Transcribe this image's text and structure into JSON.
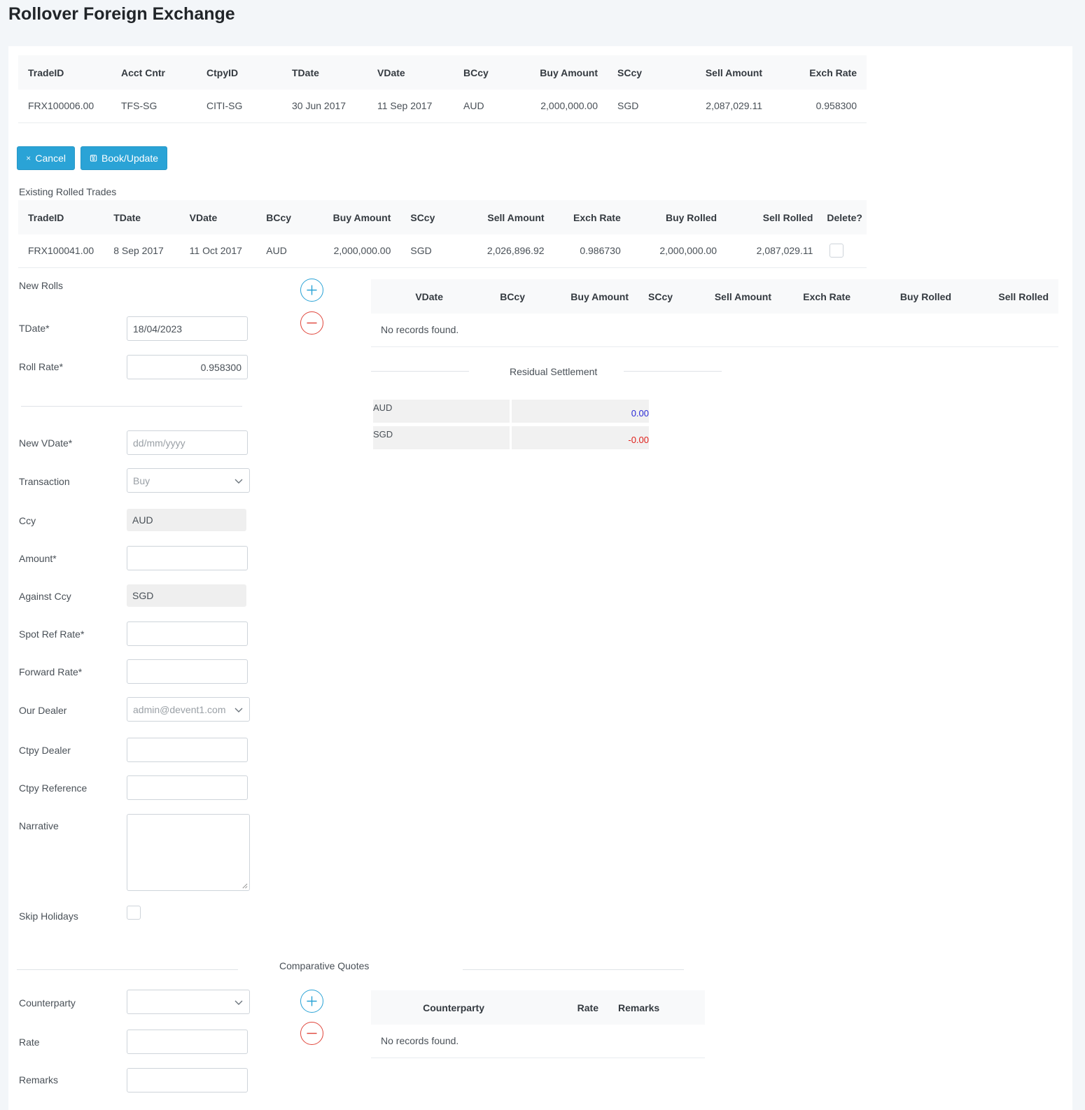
{
  "title": "Rollover Foreign Exchange",
  "trade": {
    "headers": [
      "TradeID",
      "Acct Cntr",
      "CtpyID",
      "TDate",
      "VDate",
      "BCcy",
      "Buy Amount",
      "SCcy",
      "Sell Amount",
      "Exch Rate"
    ],
    "row": [
      "FRX100006.00",
      "TFS-SG",
      "CITI-SG",
      "30 Jun 2017",
      "11 Sep 2017",
      "AUD",
      "2,000,000.00",
      "SGD",
      "2,087,029.11",
      "0.958300"
    ]
  },
  "buttons": {
    "cancel": "Cancel",
    "book": "Book/Update"
  },
  "existing": {
    "caption": "Existing Rolled Trades",
    "headers": [
      "TradeID",
      "TDate",
      "VDate",
      "BCcy",
      "Buy Amount",
      "SCcy",
      "Sell Amount",
      "Exch Rate",
      "Buy Rolled",
      "Sell Rolled",
      "Delete?"
    ],
    "row": [
      "FRX100041.00",
      "8 Sep 2017",
      "11 Oct 2017",
      "AUD",
      "2,000,000.00",
      "SGD",
      "2,026,896.92",
      "0.986730",
      "2,000,000.00",
      "2,087,029.11"
    ]
  },
  "new_rolls": {
    "caption": "New Rolls",
    "headers": [
      "VDate",
      "BCcy",
      "Buy Amount",
      "SCcy",
      "Sell Amount",
      "Exch Rate",
      "Buy Rolled",
      "Sell Rolled"
    ],
    "empty": "No records found."
  },
  "form": {
    "tdate_label": "TDate*",
    "tdate_value": "18/04/2023",
    "rollrate_label": "Roll Rate*",
    "rollrate_value": "0.958300",
    "newvdate_label": "New VDate*",
    "newvdate_placeholder": "dd/mm/yyyy",
    "transaction_label": "Transaction",
    "transaction_value": "Buy",
    "ccy_label": "Ccy",
    "ccy_value": "AUD",
    "amount_label": "Amount*",
    "against_label": "Against Ccy",
    "against_value": "SGD",
    "spot_label": "Spot Ref Rate*",
    "forward_label": "Forward Rate*",
    "dealer_label": "Our Dealer",
    "dealer_value": "admin@devent1.com",
    "ctpy_dealer_label": "Ctpy Dealer",
    "ctpy_ref_label": "Ctpy Reference",
    "narrative_label": "Narrative",
    "skip_label": "Skip Holidays"
  },
  "residual": {
    "caption": "Residual Settlement",
    "rows": [
      {
        "ccy": "AUD",
        "value": "0.00",
        "color": "#2a2ad6"
      },
      {
        "ccy": "SGD",
        "value": "-0.00",
        "color": "#e0201b"
      }
    ]
  },
  "quotes": {
    "caption": "Comparative Quotes",
    "counterparty_label": "Counterparty",
    "rate_label": "Rate",
    "remarks_label": "Remarks",
    "headers": [
      "Counterparty",
      "Rate",
      "Remarks"
    ],
    "empty": "No records found."
  }
}
